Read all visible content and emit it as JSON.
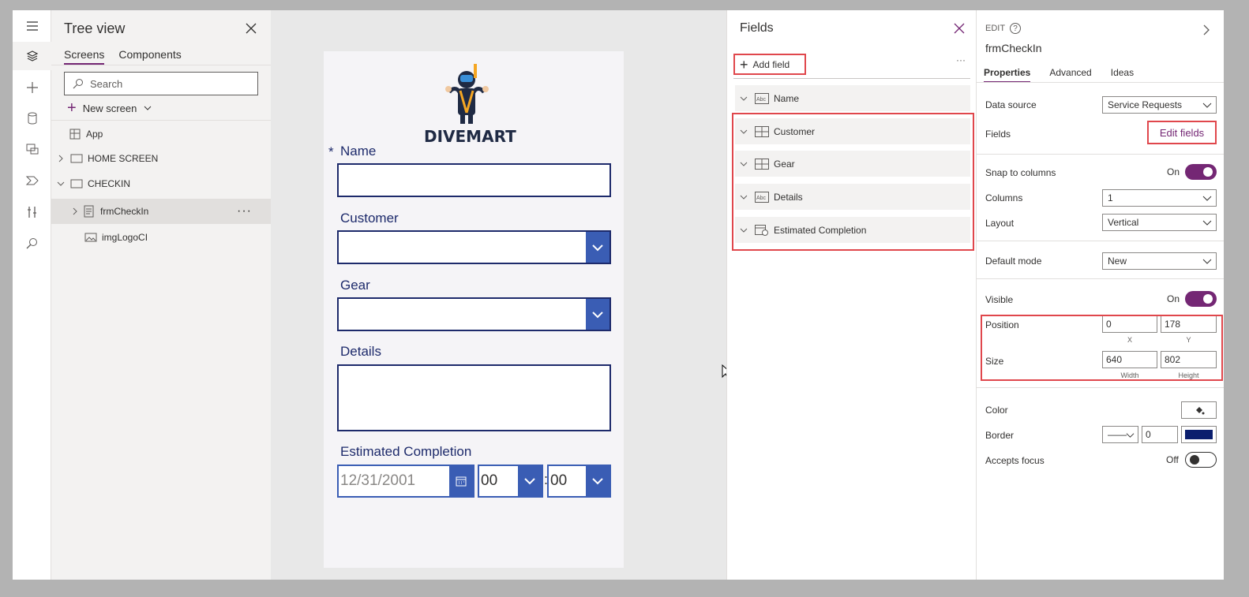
{
  "tree_view": {
    "title": "Tree view",
    "tabs": [
      "Screens",
      "Components"
    ],
    "search_placeholder": "Search",
    "new_screen_label": "New screen",
    "nodes": [
      {
        "label": "App"
      },
      {
        "label": "HOME SCREEN"
      },
      {
        "label": "CHECKIN"
      },
      {
        "label": "frmCheckIn"
      },
      {
        "label": "imgLogoCI"
      }
    ],
    "more": "···"
  },
  "canvas": {
    "logo_text": "DIVEMART",
    "required_mark": "*",
    "fields": {
      "name_label": "Name",
      "customer_label": "Customer",
      "gear_label": "Gear",
      "details_label": "Details",
      "completion_label": "Estimated Completion"
    },
    "date_placeholder": "12/31/2001",
    "hour_value": "00",
    "time_sep": ":",
    "minute_value": "00"
  },
  "fields_pane": {
    "title": "Fields",
    "add_field": "Add field",
    "more": "···",
    "items": [
      {
        "label": "Name",
        "type": "text"
      },
      {
        "label": "Customer",
        "type": "combobox"
      },
      {
        "label": "Gear",
        "type": "combobox"
      },
      {
        "label": "Details",
        "type": "text"
      },
      {
        "label": "Estimated Completion",
        "type": "datetime"
      }
    ],
    "type_text": "Abc"
  },
  "properties": {
    "edit_label": "EDIT",
    "help": "?",
    "control_name": "frmCheckIn",
    "tabs": [
      "Properties",
      "Advanced",
      "Ideas"
    ],
    "data_source_label": "Data source",
    "data_source_value": "Service Requests",
    "fields_label": "Fields",
    "edit_fields": "Edit fields",
    "snap_label": "Snap to columns",
    "snap_state": "On",
    "columns_label": "Columns",
    "columns_value": "1",
    "layout_label": "Layout",
    "layout_value": "Vertical",
    "default_mode_label": "Default mode",
    "default_mode_value": "New",
    "visible_label": "Visible",
    "visible_state": "On",
    "position_label": "Position",
    "x_value": "0",
    "y_value": "178",
    "x_caption": "X",
    "y_caption": "Y",
    "size_label": "Size",
    "width_value": "640",
    "height_value": "802",
    "width_caption": "Width",
    "height_caption": "Height",
    "color_label": "Color",
    "border_label": "Border",
    "border_style": "——",
    "border_width": "0",
    "border_color": "#0b1e6e",
    "focus_label": "Accepts focus",
    "focus_state": "Off"
  },
  "colors": {
    "accent": "#742774",
    "highlight_red": "#e0474c",
    "form_blue": "#3a5db4",
    "form_text": "#1d2a6b"
  }
}
